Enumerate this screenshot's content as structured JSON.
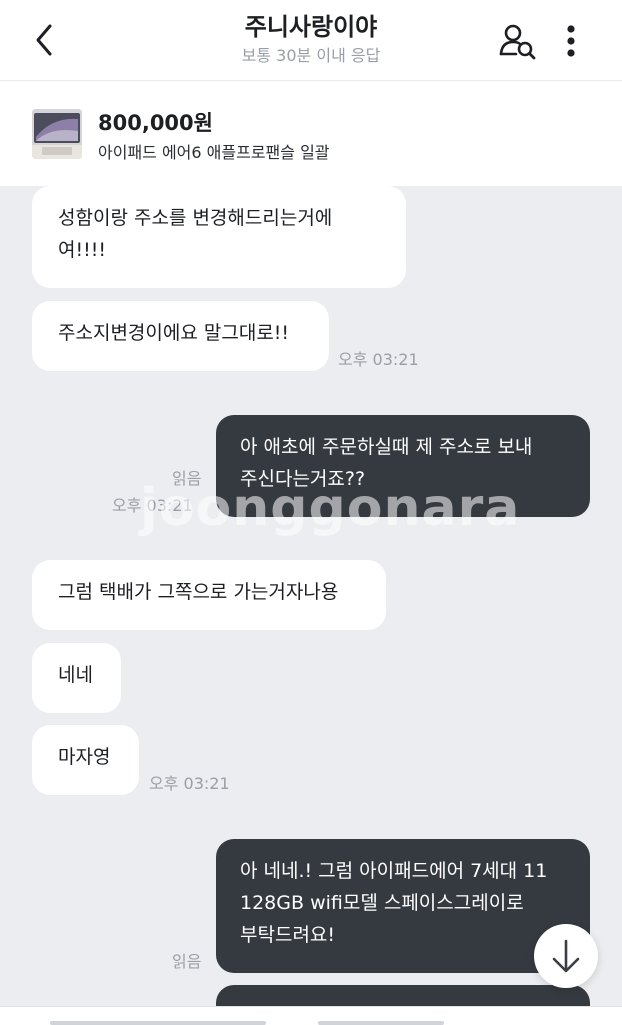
{
  "header": {
    "title": "주니사랑이야",
    "subtitle": "보통 30분 이내 응답"
  },
  "product": {
    "price": "800,000원",
    "name": "아이패드 에어6 애플프로팬슬 일괄"
  },
  "messages": [
    {
      "side": "in",
      "lines": [
        "성함이랑 주소를 변경해드리는거에",
        "여!!!!"
      ]
    },
    {
      "side": "in",
      "lines": [
        "주소지변경이에요 말그대로!!"
      ],
      "time": "오후 03:21"
    },
    {
      "side": "out",
      "lines": [
        "아 애초에 주문하실때 제 주소로 보내",
        "주신다는거죠??"
      ],
      "read": "읽음",
      "time": "오후 03:21"
    },
    {
      "side": "in",
      "lines": [
        "그럼 택배가 그쪽으로 가는거자나용"
      ]
    },
    {
      "side": "in",
      "lines": [
        "네네"
      ]
    },
    {
      "side": "in",
      "lines": [
        "마자영"
      ],
      "time": "오후 03:21"
    },
    {
      "side": "out",
      "lines": [
        "아 네네.! 그럼 아이패드에어 7세대 11",
        "128GB wifi모델 스페이스그레이로",
        "부탁드려요!"
      ],
      "read": "읽음"
    }
  ],
  "watermark": "joonggonara",
  "icons": {
    "back": "back-arrow-icon",
    "user_search": "user-search-icon",
    "more": "more-vertical-icon",
    "scroll_down": "arrow-down-icon"
  },
  "colors": {
    "background": "#ebedf0",
    "incoming_bubble": "#ffffff",
    "outgoing_bubble": "#353940",
    "meta_text": "#9a9ea6"
  }
}
